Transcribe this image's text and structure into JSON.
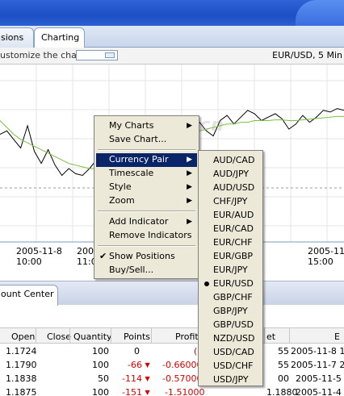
{
  "window": {
    "title_bar": ""
  },
  "tabs": [
    {
      "label": "sions"
    },
    {
      "label": "Charting"
    }
  ],
  "toolbar": {
    "customize_label": "ustomize the chart",
    "symbol_timeframe": "EUR/USD, 5 Min"
  },
  "watermark": "arketiva.cn",
  "chart_data": {
    "type": "line",
    "title": "",
    "series": [
      {
        "values": [
          2.2,
          2.3,
          2.05,
          1.8,
          2.45,
          1.7,
          1.35,
          1.75,
          1.3,
          1.0,
          1.2,
          1.05,
          1.0,
          1.2,
          1.45,
          1.15,
          1.0,
          1.1,
          1.05,
          1.15,
          1.1,
          1.3,
          2.1,
          2.45,
          2.3,
          2.55,
          2.35,
          2.45,
          2.2,
          2.55,
          2.3,
          2.15,
          2.6,
          2.75,
          2.5,
          2.7,
          2.9,
          2.8,
          2.6,
          2.7,
          2.8,
          2.65,
          2.35,
          2.5,
          2.75,
          2.55,
          2.7,
          2.9,
          2.85,
          2.95,
          2.9
        ]
      },
      {
        "values": [
          2.6,
          2.4,
          2.2,
          2.05,
          1.95,
          1.85,
          1.75,
          1.65,
          1.55,
          1.45,
          1.35,
          1.3,
          1.25,
          1.2,
          1.2,
          1.2,
          1.2,
          1.18,
          1.15,
          1.15,
          1.2,
          1.3,
          1.45,
          1.6,
          1.75,
          1.9,
          2.0,
          2.1,
          2.2,
          2.3,
          2.35,
          2.4,
          2.45,
          2.5,
          2.5,
          2.55,
          2.55,
          2.6,
          2.6,
          2.6,
          2.62,
          2.62,
          2.6,
          2.6,
          2.62,
          2.64,
          2.66,
          2.68,
          2.7,
          2.72,
          2.72
        ]
      }
    ],
    "colors": {
      "price": "#000000",
      "average": "#7ac142",
      "grid": "#e4e4e4",
      "dashed": "#9a9a9a",
      "axis": "#7f9db9"
    },
    "x_labels": [
      "2005-11-8\n10:00",
      "2005-11-8\n11:0",
      "2005-11-8\n15:00"
    ]
  },
  "context_menu": {
    "items": [
      {
        "label": "My Charts",
        "submenu": true
      },
      {
        "label": "Save Chart...",
        "submenu": false
      },
      {
        "label": "Currency Pair",
        "submenu": true,
        "highlighted": true
      },
      {
        "label": "Timescale",
        "submenu": true
      },
      {
        "label": "Style",
        "submenu": true
      },
      {
        "label": "Zoom",
        "submenu": true
      },
      {
        "label": "Add Indicator",
        "submenu": true
      },
      {
        "label": "Remove Indicators",
        "submenu": false
      },
      {
        "label": "Show Positions",
        "checked": true
      },
      {
        "label": "Buy/Sell...",
        "submenu": false
      }
    ]
  },
  "currency_submenu": {
    "selected": "EUR/USD",
    "items": [
      "AUD/CAD",
      "AUD/JPY",
      "AUD/USD",
      "CHF/JPY",
      "EUR/AUD",
      "EUR/CAD",
      "EUR/CHF",
      "EUR/GBP",
      "EUR/JPY",
      "EUR/USD",
      "GBP/CHF",
      "GBP/JPY",
      "GBP/USD",
      "NZD/USD",
      "USD/CAD",
      "USD/CHF",
      "USD/JPY"
    ]
  },
  "lower_panel": {
    "tab_label": "ount Center"
  },
  "positions_table": {
    "headers": [
      "Open",
      "Close",
      "Quantity",
      "Points",
      "Profit",
      "et",
      "E"
    ],
    "rows": [
      {
        "open": "1.1724",
        "close": "",
        "quantity": "100",
        "points": "0",
        "profit": "(",
        "price": "55",
        "time": "2005-11-8 12",
        "red": false
      },
      {
        "open": "1.1790",
        "close": "",
        "quantity": "100",
        "points": "-66",
        "profit": "-0.66000",
        "price": "55",
        "time": "2005-11-7 22",
        "red": true
      },
      {
        "open": "1.1838",
        "close": "",
        "quantity": "50",
        "points": "-114",
        "profit": "-0.57000",
        "price": "00",
        "time": "2005-11-5 0",
        "red": true
      },
      {
        "open": "1.1875",
        "close": "",
        "quantity": "100",
        "points": "-151",
        "profit": "-1.51000",
        "price": "1.1880",
        "time": "2005-11-4 23",
        "red": true
      }
    ]
  }
}
